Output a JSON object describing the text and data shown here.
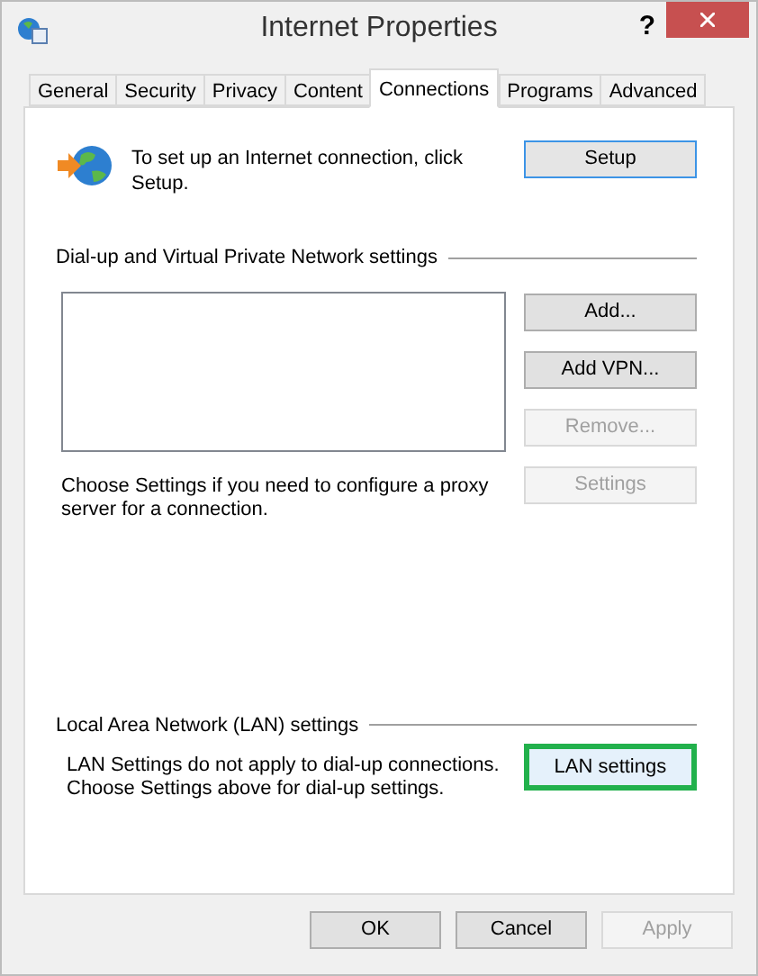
{
  "window": {
    "title": "Internet Properties",
    "help": "?"
  },
  "tabs": [
    {
      "label": "General",
      "selected": false
    },
    {
      "label": "Security",
      "selected": false
    },
    {
      "label": "Privacy",
      "selected": false
    },
    {
      "label": "Content",
      "selected": false
    },
    {
      "label": "Connections",
      "selected": true
    },
    {
      "label": "Programs",
      "selected": false
    },
    {
      "label": "Advanced",
      "selected": false
    }
  ],
  "setup": {
    "text": "To set up an Internet connection, click Setup.",
    "button": {
      "label": "Setup",
      "focused": true
    }
  },
  "dialup": {
    "heading": "Dial-up and Virtual Private Network settings",
    "buttons": [
      {
        "label": "Add...",
        "disabled": false
      },
      {
        "label": "Add VPN...",
        "disabled": false
      },
      {
        "label": "Remove...",
        "disabled": true
      },
      {
        "label": "Settings",
        "disabled": true
      }
    ],
    "note": "Choose Settings if you need to configure a proxy server for a connection."
  },
  "lan": {
    "heading": "Local Area Network (LAN) settings",
    "note": "LAN Settings do not apply to dial-up connections. Choose Settings above for dial-up settings.",
    "button": {
      "label": "LAN settings",
      "highlighted": true
    }
  },
  "footer_buttons": [
    {
      "label": "OK",
      "disabled": false
    },
    {
      "label": "Cancel",
      "disabled": false
    },
    {
      "label": "Apply",
      "disabled": true
    }
  ]
}
